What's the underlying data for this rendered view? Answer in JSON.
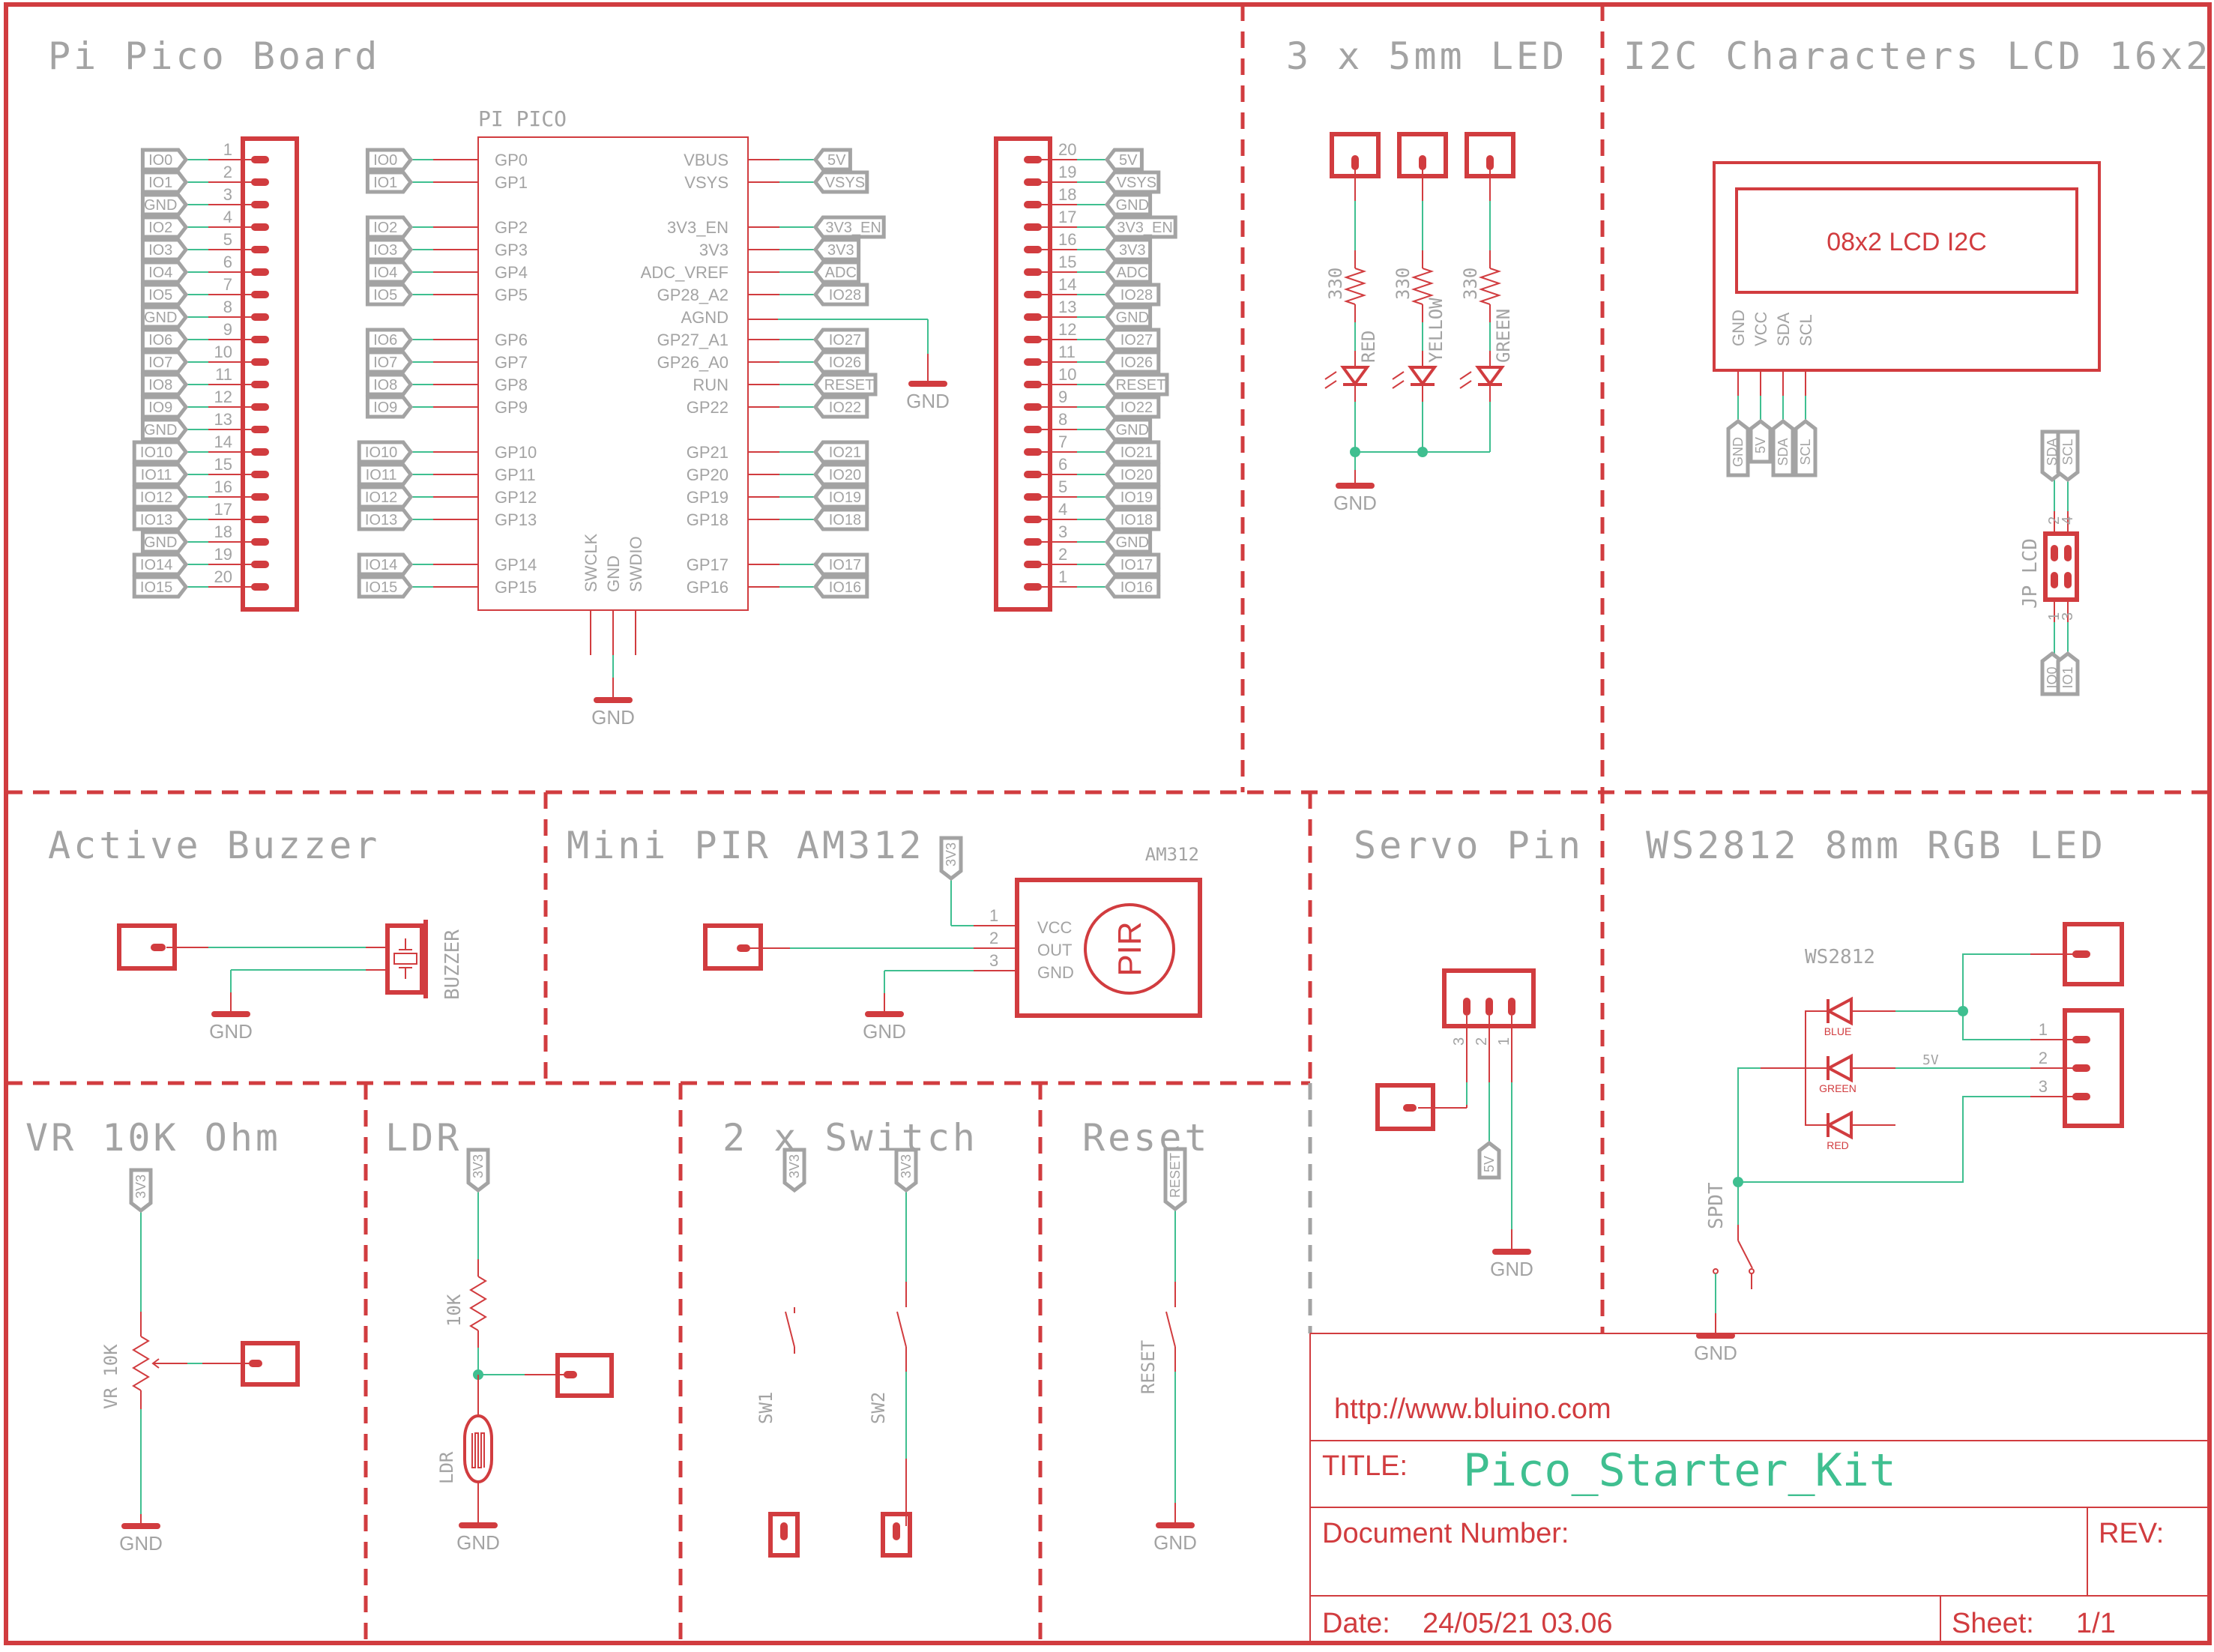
{
  "colors": {
    "accent": "#d13c3f",
    "net": "#3fbf90",
    "label": "#a3a3a3"
  },
  "sections": {
    "pico_board": "Pi Pico Board",
    "leds": "3 x 5mm LED",
    "lcd": "I2C Characters LCD 16x2",
    "buzzer": "Active Buzzer",
    "pir": "Mini PIR AM312",
    "servo": "Servo Pin",
    "ws2812": "WS2812 8mm RGB LED",
    "vr": "VR 10K Ohm",
    "ldr": "LDR",
    "switch": "2 x Switch",
    "reset": "Reset"
  },
  "pico": {
    "name": "PI PICO",
    "left_header": {
      "pins": [
        "1",
        "2",
        "3",
        "4",
        "5",
        "6",
        "7",
        "8",
        "9",
        "10",
        "11",
        "12",
        "13",
        "14",
        "15",
        "16",
        "17",
        "18",
        "19",
        "20"
      ],
      "nets": [
        "IO0",
        "IO1",
        "GND",
        "IO2",
        "IO3",
        "IO4",
        "IO5",
        "GND",
        "IO6",
        "IO7",
        "IO8",
        "IO9",
        "GND",
        "IO10",
        "IO11",
        "IO12",
        "IO13",
        "GND",
        "IO14",
        "IO15"
      ]
    },
    "right_header": {
      "pins": [
        "20",
        "19",
        "18",
        "17",
        "16",
        "15",
        "14",
        "13",
        "12",
        "11",
        "10",
        "9",
        "8",
        "7",
        "6",
        "5",
        "4",
        "3",
        "2",
        "1"
      ],
      "nets": [
        "5V",
        "VSYS",
        "GND",
        "3V3_EN",
        "3V3",
        "ADC",
        "IO28",
        "GND",
        "IO27",
        "IO26",
        "RESET",
        "IO22",
        "GND",
        "IO21",
        "IO20",
        "IO19",
        "IO18",
        "GND",
        "IO17",
        "IO16"
      ]
    },
    "chip_left": [
      {
        "pin": "GP0",
        "net": "IO0"
      },
      {
        "pin": "GP1",
        "net": "IO1"
      },
      {
        "pin": "",
        "net": ""
      },
      {
        "pin": "GP2",
        "net": "IO2"
      },
      {
        "pin": "GP3",
        "net": "IO3"
      },
      {
        "pin": "GP4",
        "net": "IO4"
      },
      {
        "pin": "GP5",
        "net": "IO5"
      },
      {
        "pin": "",
        "net": ""
      },
      {
        "pin": "GP6",
        "net": "IO6"
      },
      {
        "pin": "GP7",
        "net": "IO7"
      },
      {
        "pin": "GP8",
        "net": "IO8"
      },
      {
        "pin": "GP9",
        "net": "IO9"
      },
      {
        "pin": "",
        "net": ""
      },
      {
        "pin": "GP10",
        "net": "IO10"
      },
      {
        "pin": "GP11",
        "net": "IO11"
      },
      {
        "pin": "GP12",
        "net": "IO12"
      },
      {
        "pin": "GP13",
        "net": "IO13"
      },
      {
        "pin": "",
        "net": ""
      },
      {
        "pin": "GP14",
        "net": "IO14"
      },
      {
        "pin": "GP15",
        "net": "IO15"
      }
    ],
    "chip_right": [
      {
        "pin": "VBUS",
        "net": "5V"
      },
      {
        "pin": "VSYS",
        "net": "VSYS"
      },
      {
        "pin": "",
        "net": ""
      },
      {
        "pin": "3V3_EN",
        "net": "3V3_EN"
      },
      {
        "pin": "3V3",
        "net": "3V3"
      },
      {
        "pin": "ADC_VREF",
        "net": "ADC"
      },
      {
        "pin": "GP28_A2",
        "net": "IO28"
      },
      {
        "pin": "AGND",
        "net": ""
      },
      {
        "pin": "GP27_A1",
        "net": "IO27"
      },
      {
        "pin": "GP26_A0",
        "net": "IO26"
      },
      {
        "pin": "RUN",
        "net": "RESET"
      },
      {
        "pin": "GP22",
        "net": "IO22"
      },
      {
        "pin": "",
        "net": ""
      },
      {
        "pin": "GP21",
        "net": "IO21"
      },
      {
        "pin": "GP20",
        "net": "IO20"
      },
      {
        "pin": "GP19",
        "net": "IO19"
      },
      {
        "pin": "GP18",
        "net": "IO18"
      },
      {
        "pin": "",
        "net": ""
      },
      {
        "pin": "GP17",
        "net": "IO17"
      },
      {
        "pin": "GP16",
        "net": "IO16"
      }
    ],
    "chip_bottom": [
      "SWCLK",
      "GND",
      "SWDIO"
    ],
    "gnd_label": "GND",
    "agnd_gnd_label": "GND"
  },
  "leds": {
    "resistors": [
      "330",
      "330",
      "330"
    ],
    "colors": [
      "RED",
      "YELLOW",
      "GREEN"
    ],
    "gnd_label": "GND"
  },
  "lcd": {
    "display_text": "08x2 LCD I2C",
    "pins": [
      "GND",
      "VCC",
      "SDA",
      "SCL"
    ],
    "nets": [
      "GND",
      "5V",
      "SDA",
      "SCL"
    ],
    "jumper_name": "JP LCD",
    "jumper_top_nets": [
      "SDA",
      "SCL"
    ],
    "jumper_top_pins": [
      "2",
      "4"
    ],
    "jumper_bottom_pins": [
      "1",
      "3"
    ],
    "jumper_bottom_nets": [
      "IO0",
      "IO1"
    ]
  },
  "buzzer": {
    "part_label": "BUZZER",
    "gnd_label": "GND"
  },
  "pir": {
    "part_name": "AM312",
    "supply_net": "3V3",
    "pins": [
      "1",
      "2",
      "3"
    ],
    "pin_names": [
      "VCC",
      "OUT",
      "GND"
    ],
    "symbol_text": "PIR",
    "gnd_label": "GND"
  },
  "servo": {
    "pins": [
      "3",
      "2",
      "1"
    ],
    "supply_net": "5V",
    "gnd_label": "GND"
  },
  "ws2812": {
    "part_name": "WS2812",
    "led_labels": [
      "BLUE",
      "GREEN",
      "RED"
    ],
    "pins": [
      "1",
      "2",
      "3"
    ],
    "net_label": "5V",
    "switch_label": "SPDT",
    "gnd_label": "GND"
  },
  "vr": {
    "supply_net": "3V3",
    "part_label": "VR 10K",
    "gnd_label": "GND"
  },
  "ldr": {
    "supply_net": "3V3",
    "resistor_label": "10K",
    "part_label": "LDR",
    "gnd_label": "GND"
  },
  "switches": {
    "supply_nets": [
      "3V3",
      "3V3"
    ],
    "labels": [
      "SW1",
      "SW2"
    ]
  },
  "reset": {
    "net": "RESET",
    "switch_label": "RESET",
    "gnd_label": "GND"
  },
  "title_block": {
    "url": "http://www.bluino.com",
    "title_label": "TITLE:",
    "title": "Pico_Starter_Kit",
    "doc_label": "Document Number:",
    "rev_label": "REV:",
    "date_label": "Date:",
    "date": "24/05/21 03.06",
    "sheet_label": "Sheet:",
    "sheet": "1/1"
  }
}
